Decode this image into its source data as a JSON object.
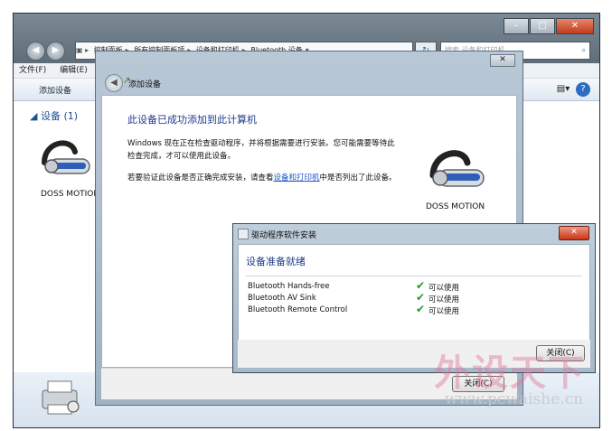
{
  "explorer": {
    "breadcrumb": [
      "控制面板",
      "所有控制面板项",
      "设备和打印机",
      "Bluetooth 设备"
    ],
    "search_placeholder": "搜索 设备和打印机",
    "menu": [
      "文件(F)",
      "编辑(E)"
    ],
    "toolbar_add": "添加设备",
    "group_header": "设备 (1)",
    "device_label": "DOSS MOTION",
    "status_count": "1"
  },
  "add_dialog": {
    "title": "添加设备",
    "heading": "此设备已成功添加到此计算机",
    "para1": "Windows 现在正在检查驱动程序，并将根据需要进行安装。您可能需要等待此检查完成，才可以使用此设备。",
    "para2_prefix": "若要验证此设备是否正确完成安装，请查看",
    "para2_link": "设备和打印机",
    "para2_suffix": "中是否列出了此设备。",
    "device_label": "DOSS MOTION",
    "close_label": "关闭(C)"
  },
  "driver_dialog": {
    "title": "驱动程序软件安装",
    "heading": "设备准备就绪",
    "items": [
      {
        "name": "Bluetooth Hands-free",
        "status": "可以使用"
      },
      {
        "name": "Bluetooth AV Sink",
        "status": "可以使用"
      },
      {
        "name": "Bluetooth Remote Control",
        "status": "可以使用"
      }
    ],
    "close_label": "关闭(C)"
  },
  "watermark": {
    "text": "外设天下",
    "url": "www.pcwaishe.cn"
  },
  "colors": {
    "heading_blue": "#1e3c8c",
    "link_blue": "#1a55c8",
    "check_green": "#1f9b28",
    "close_red": "#c8341a"
  }
}
